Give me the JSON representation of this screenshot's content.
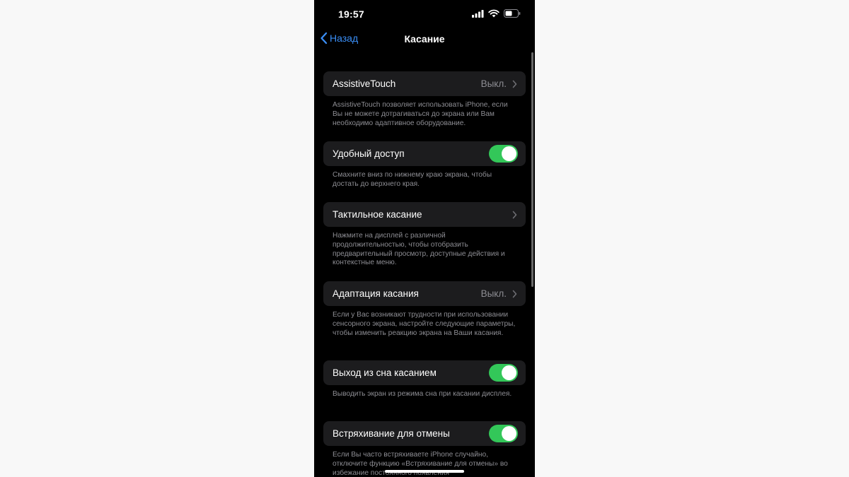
{
  "status_bar": {
    "time": "19:57",
    "icons": [
      "cellular-signal-icon",
      "wifi-icon",
      "battery-icon"
    ]
  },
  "nav": {
    "back_label": "Назад",
    "title": "Касание"
  },
  "settings": [
    {
      "label": "AssistiveTouch",
      "value": "Выкл.",
      "footer": "AssistiveTouch позволяет использовать iPhone, если Вы не можете дотрагиваться до экрана или Вам необходимо адаптивное оборудование."
    },
    {
      "label": "Удобный доступ",
      "toggle_on": true,
      "footer": "Смахните вниз по нижнему краю экрана, чтобы достать до верхнего края."
    },
    {
      "label": "Тактильное касание",
      "footer": "Нажмите на дисплей с различной продолжительностью, чтобы отобразить предварительный просмотр, доступные действия и контекстные меню."
    },
    {
      "label": "Адаптация касания",
      "value": "Выкл.",
      "footer": "Если у Вас возникают трудности при использовании сенсорного экрана, настройте следующие параметры, чтобы изменить реакцию экрана на Ваши касания."
    },
    {
      "label": "Выход из сна касанием",
      "toggle_on": true,
      "footer": "Выводить экран из режима сна при касании дисплея."
    },
    {
      "label": "Встряхивание для отмены",
      "toggle_on": true,
      "footer": "Если Вы часто встряхиваете iPhone случайно, отключите функцию «Встряхивание для отмены» во избежание постоянного появления"
    }
  ],
  "colors": {
    "accent": "#3a8ef6",
    "toggle_on": "#33c759",
    "cell_bg": "#1c1c1e",
    "secondary_text": "#8d8d93"
  }
}
